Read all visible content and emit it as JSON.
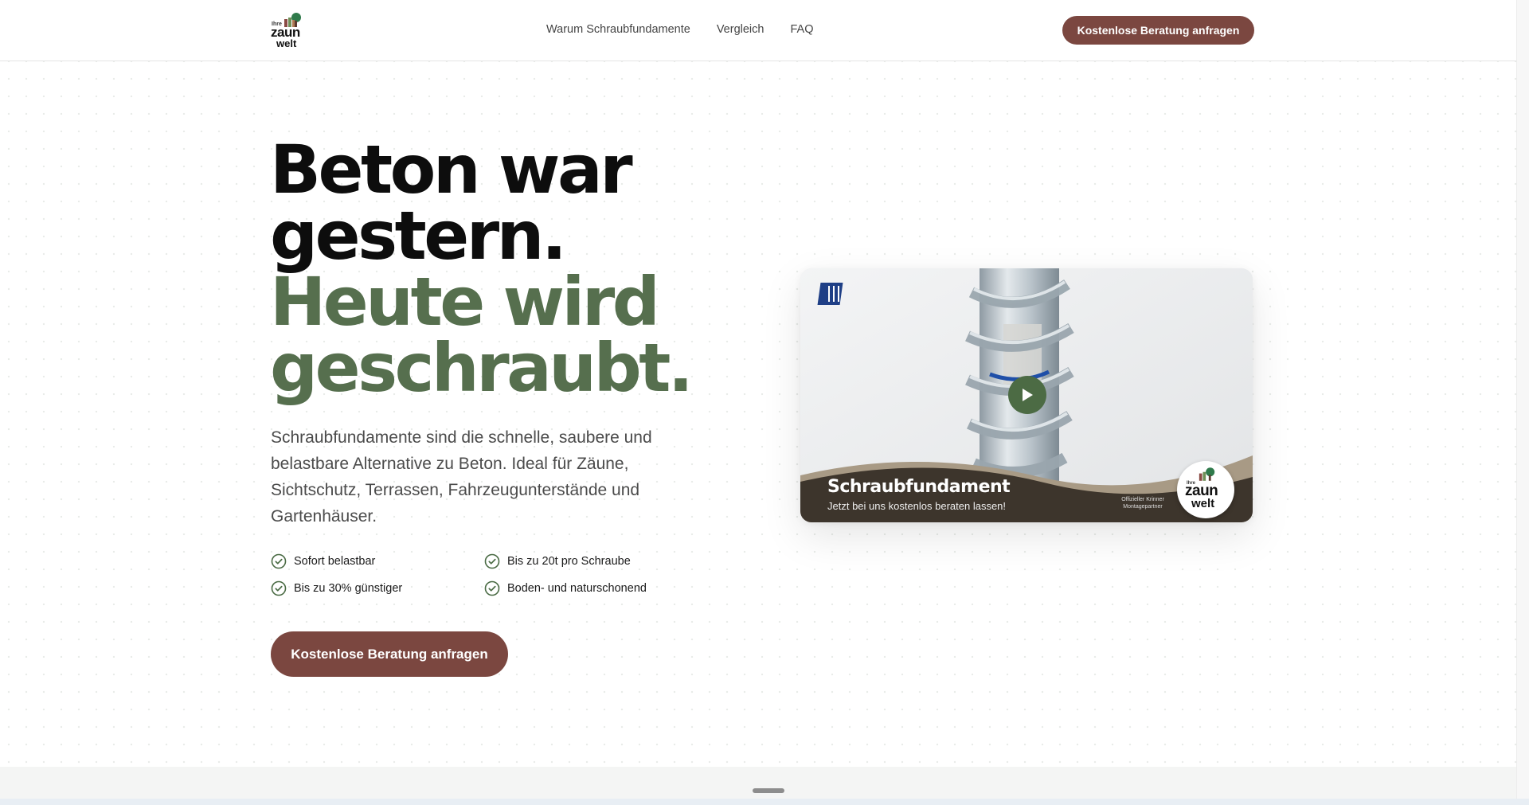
{
  "header": {
    "logo": {
      "small": "Ihre",
      "line1": "zaun",
      "line2": "welt"
    },
    "nav": [
      {
        "label": "Warum Schraubfundamente"
      },
      {
        "label": "Vergleich"
      },
      {
        "label": "FAQ"
      }
    ],
    "cta_label": "Kostenlose Beratung anfragen"
  },
  "hero": {
    "headline_dark": [
      "Beton war",
      "gestern."
    ],
    "headline_green": [
      "Heute wird",
      "geschraubt."
    ],
    "lead": "Schraubfundamente sind die schnelle, saubere und belastbare Alternative zu Beton. Ideal für Zäune, Sichtschutz, Terrassen, Fahrzeugunterstände und Gartenhäuser.",
    "features": [
      {
        "label": "Sofort belastbar",
        "icon": "check-circle-icon"
      },
      {
        "label": "Bis zu 20t pro Schraube",
        "icon": "check-circle-icon"
      },
      {
        "label": "Bis zu 30% günstiger",
        "icon": "check-circle-icon"
      },
      {
        "label": "Boden- und naturschonend",
        "icon": "check-circle-icon"
      }
    ],
    "cta_label": "Kostenlose Beratung anfragen"
  },
  "video": {
    "title": "Schraubfundament",
    "subtitle": "Jetzt bei uns kostenlos beraten lassen!",
    "partner_line1": "Offizieller Krinner",
    "partner_line2": "Montagepartner",
    "badge": {
      "small": "Ihre",
      "line1": "zaun",
      "line2": "welt"
    },
    "play_icon": "play-icon"
  },
  "colors": {
    "accent_brown": "#7b4740",
    "headline_green": "#566f4e",
    "play_green": "#4c6b44",
    "check_green": "#4a6b44"
  }
}
